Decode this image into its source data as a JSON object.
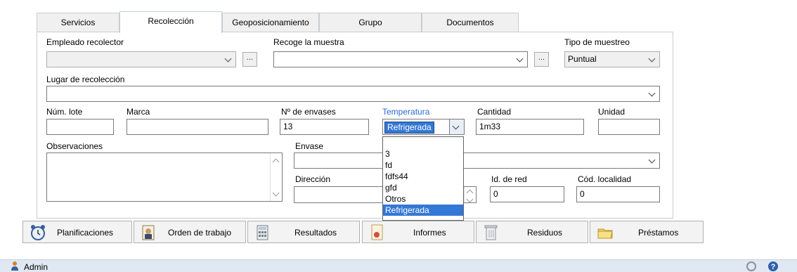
{
  "tabs": [
    {
      "label": "Servicios"
    },
    {
      "label": "Recolección"
    },
    {
      "label": "Geoposicionamiento"
    },
    {
      "label": "Grupo"
    },
    {
      "label": "Documentos"
    }
  ],
  "active_tab": "Recolección",
  "form": {
    "empleado_recolector": {
      "label": "Empleado recolector",
      "value": ""
    },
    "recoge_muestra": {
      "label": "Recoge la muestra",
      "value": ""
    },
    "tipo_muestreo": {
      "label": "Tipo de muestreo",
      "value": "Puntual"
    },
    "lugar_recoleccion": {
      "label": "Lugar de recolección",
      "value": ""
    },
    "num_lote": {
      "label": "Núm. lote",
      "value": ""
    },
    "marca": {
      "label": "Marca",
      "value": ""
    },
    "num_envases": {
      "label": "Nº de envases",
      "value": "13"
    },
    "temperatura": {
      "label": "Temperatura",
      "value": "Refrigerada"
    },
    "cantidad": {
      "label": "Cantidad",
      "value": "1m33"
    },
    "unidad": {
      "label": "Unidad",
      "value": ""
    },
    "observaciones": {
      "label": "Observaciones",
      "value": ""
    },
    "envase": {
      "label": "Envase",
      "value": ""
    },
    "direccion": {
      "label": "Dirección",
      "value": ""
    },
    "id_red": {
      "label": "Id. de red",
      "value": "0"
    },
    "cod_localidad": {
      "label": "Cód. localidad",
      "value": "0"
    },
    "browse_label": "..."
  },
  "temperatura_options": [
    "",
    "3",
    "fd",
    "fdfs44",
    "gfd",
    "Otros",
    "Refrigerada"
  ],
  "temperatura_selected": "Refrigerada",
  "buttons": [
    {
      "label": "Planificaciones",
      "icon": "alarm-clock-icon"
    },
    {
      "label": "Orden de trabajo",
      "icon": "worker-icon"
    },
    {
      "label": "Resultados",
      "icon": "calculator-icon"
    },
    {
      "label": "Informes",
      "icon": "report-icon"
    },
    {
      "label": "Residuos",
      "icon": "trash-bin-icon"
    },
    {
      "label": "Préstamos",
      "icon": "folder-icon"
    }
  ],
  "status": {
    "user": "Admin"
  },
  "colors": {
    "selection": "#3478d6",
    "label_accent": "#2a6bd1",
    "statusbar": "#dfe8f3"
  }
}
